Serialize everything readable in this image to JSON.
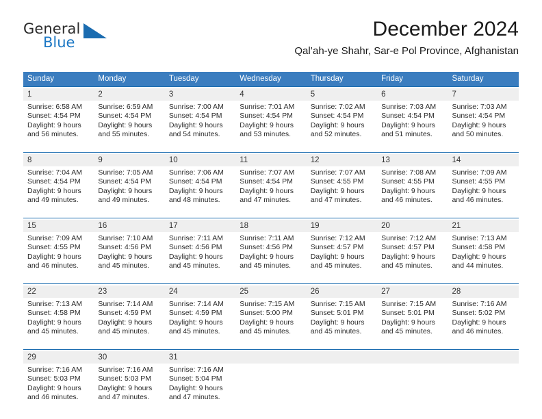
{
  "logo": {
    "word_top": "General",
    "word_bottom": "Blue",
    "triangle_color": "#1b6cb0",
    "blue_color": "#1b77c4"
  },
  "header": {
    "title": "December 2024",
    "subtitle": "Qal’ah-ye Shahr, Sar-e Pol Province, Afghanistan"
  },
  "theme": {
    "header_bg": "#3b7dbf",
    "separator": "#1b6cb0",
    "daynum_bg": "#efefef"
  },
  "weekday_headers": [
    "Sunday",
    "Monday",
    "Tuesday",
    "Wednesday",
    "Thursday",
    "Friday",
    "Saturday"
  ],
  "weeks": [
    {
      "days": [
        {
          "num": "1",
          "sunrise": "Sunrise: 6:58 AM",
          "sunset": "Sunset: 4:54 PM",
          "daylight1": "Daylight: 9 hours",
          "daylight2": "and 56 minutes."
        },
        {
          "num": "2",
          "sunrise": "Sunrise: 6:59 AM",
          "sunset": "Sunset: 4:54 PM",
          "daylight1": "Daylight: 9 hours",
          "daylight2": "and 55 minutes."
        },
        {
          "num": "3",
          "sunrise": "Sunrise: 7:00 AM",
          "sunset": "Sunset: 4:54 PM",
          "daylight1": "Daylight: 9 hours",
          "daylight2": "and 54 minutes."
        },
        {
          "num": "4",
          "sunrise": "Sunrise: 7:01 AM",
          "sunset": "Sunset: 4:54 PM",
          "daylight1": "Daylight: 9 hours",
          "daylight2": "and 53 minutes."
        },
        {
          "num": "5",
          "sunrise": "Sunrise: 7:02 AM",
          "sunset": "Sunset: 4:54 PM",
          "daylight1": "Daylight: 9 hours",
          "daylight2": "and 52 minutes."
        },
        {
          "num": "6",
          "sunrise": "Sunrise: 7:03 AM",
          "sunset": "Sunset: 4:54 PM",
          "daylight1": "Daylight: 9 hours",
          "daylight2": "and 51 minutes."
        },
        {
          "num": "7",
          "sunrise": "Sunrise: 7:03 AM",
          "sunset": "Sunset: 4:54 PM",
          "daylight1": "Daylight: 9 hours",
          "daylight2": "and 50 minutes."
        }
      ]
    },
    {
      "days": [
        {
          "num": "8",
          "sunrise": "Sunrise: 7:04 AM",
          "sunset": "Sunset: 4:54 PM",
          "daylight1": "Daylight: 9 hours",
          "daylight2": "and 49 minutes."
        },
        {
          "num": "9",
          "sunrise": "Sunrise: 7:05 AM",
          "sunset": "Sunset: 4:54 PM",
          "daylight1": "Daylight: 9 hours",
          "daylight2": "and 49 minutes."
        },
        {
          "num": "10",
          "sunrise": "Sunrise: 7:06 AM",
          "sunset": "Sunset: 4:54 PM",
          "daylight1": "Daylight: 9 hours",
          "daylight2": "and 48 minutes."
        },
        {
          "num": "11",
          "sunrise": "Sunrise: 7:07 AM",
          "sunset": "Sunset: 4:54 PM",
          "daylight1": "Daylight: 9 hours",
          "daylight2": "and 47 minutes."
        },
        {
          "num": "12",
          "sunrise": "Sunrise: 7:07 AM",
          "sunset": "Sunset: 4:55 PM",
          "daylight1": "Daylight: 9 hours",
          "daylight2": "and 47 minutes."
        },
        {
          "num": "13",
          "sunrise": "Sunrise: 7:08 AM",
          "sunset": "Sunset: 4:55 PM",
          "daylight1": "Daylight: 9 hours",
          "daylight2": "and 46 minutes."
        },
        {
          "num": "14",
          "sunrise": "Sunrise: 7:09 AM",
          "sunset": "Sunset: 4:55 PM",
          "daylight1": "Daylight: 9 hours",
          "daylight2": "and 46 minutes."
        }
      ]
    },
    {
      "days": [
        {
          "num": "15",
          "sunrise": "Sunrise: 7:09 AM",
          "sunset": "Sunset: 4:55 PM",
          "daylight1": "Daylight: 9 hours",
          "daylight2": "and 46 minutes."
        },
        {
          "num": "16",
          "sunrise": "Sunrise: 7:10 AM",
          "sunset": "Sunset: 4:56 PM",
          "daylight1": "Daylight: 9 hours",
          "daylight2": "and 45 minutes."
        },
        {
          "num": "17",
          "sunrise": "Sunrise: 7:11 AM",
          "sunset": "Sunset: 4:56 PM",
          "daylight1": "Daylight: 9 hours",
          "daylight2": "and 45 minutes."
        },
        {
          "num": "18",
          "sunrise": "Sunrise: 7:11 AM",
          "sunset": "Sunset: 4:56 PM",
          "daylight1": "Daylight: 9 hours",
          "daylight2": "and 45 minutes."
        },
        {
          "num": "19",
          "sunrise": "Sunrise: 7:12 AM",
          "sunset": "Sunset: 4:57 PM",
          "daylight1": "Daylight: 9 hours",
          "daylight2": "and 45 minutes."
        },
        {
          "num": "20",
          "sunrise": "Sunrise: 7:12 AM",
          "sunset": "Sunset: 4:57 PM",
          "daylight1": "Daylight: 9 hours",
          "daylight2": "and 45 minutes."
        },
        {
          "num": "21",
          "sunrise": "Sunrise: 7:13 AM",
          "sunset": "Sunset: 4:58 PM",
          "daylight1": "Daylight: 9 hours",
          "daylight2": "and 44 minutes."
        }
      ]
    },
    {
      "days": [
        {
          "num": "22",
          "sunrise": "Sunrise: 7:13 AM",
          "sunset": "Sunset: 4:58 PM",
          "daylight1": "Daylight: 9 hours",
          "daylight2": "and 45 minutes."
        },
        {
          "num": "23",
          "sunrise": "Sunrise: 7:14 AM",
          "sunset": "Sunset: 4:59 PM",
          "daylight1": "Daylight: 9 hours",
          "daylight2": "and 45 minutes."
        },
        {
          "num": "24",
          "sunrise": "Sunrise: 7:14 AM",
          "sunset": "Sunset: 4:59 PM",
          "daylight1": "Daylight: 9 hours",
          "daylight2": "and 45 minutes."
        },
        {
          "num": "25",
          "sunrise": "Sunrise: 7:15 AM",
          "sunset": "Sunset: 5:00 PM",
          "daylight1": "Daylight: 9 hours",
          "daylight2": "and 45 minutes."
        },
        {
          "num": "26",
          "sunrise": "Sunrise: 7:15 AM",
          "sunset": "Sunset: 5:01 PM",
          "daylight1": "Daylight: 9 hours",
          "daylight2": "and 45 minutes."
        },
        {
          "num": "27",
          "sunrise": "Sunrise: 7:15 AM",
          "sunset": "Sunset: 5:01 PM",
          "daylight1": "Daylight: 9 hours",
          "daylight2": "and 45 minutes."
        },
        {
          "num": "28",
          "sunrise": "Sunrise: 7:16 AM",
          "sunset": "Sunset: 5:02 PM",
          "daylight1": "Daylight: 9 hours",
          "daylight2": "and 46 minutes."
        }
      ]
    },
    {
      "days": [
        {
          "num": "29",
          "sunrise": "Sunrise: 7:16 AM",
          "sunset": "Sunset: 5:03 PM",
          "daylight1": "Daylight: 9 hours",
          "daylight2": "and 46 minutes."
        },
        {
          "num": "30",
          "sunrise": "Sunrise: 7:16 AM",
          "sunset": "Sunset: 5:03 PM",
          "daylight1": "Daylight: 9 hours",
          "daylight2": "and 47 minutes."
        },
        {
          "num": "31",
          "sunrise": "Sunrise: 7:16 AM",
          "sunset": "Sunset: 5:04 PM",
          "daylight1": "Daylight: 9 hours",
          "daylight2": "and 47 minutes."
        },
        {
          "num": "",
          "sunrise": "",
          "sunset": "",
          "daylight1": "",
          "daylight2": ""
        },
        {
          "num": "",
          "sunrise": "",
          "sunset": "",
          "daylight1": "",
          "daylight2": ""
        },
        {
          "num": "",
          "sunrise": "",
          "sunset": "",
          "daylight1": "",
          "daylight2": ""
        },
        {
          "num": "",
          "sunrise": "",
          "sunset": "",
          "daylight1": "",
          "daylight2": ""
        }
      ]
    }
  ]
}
